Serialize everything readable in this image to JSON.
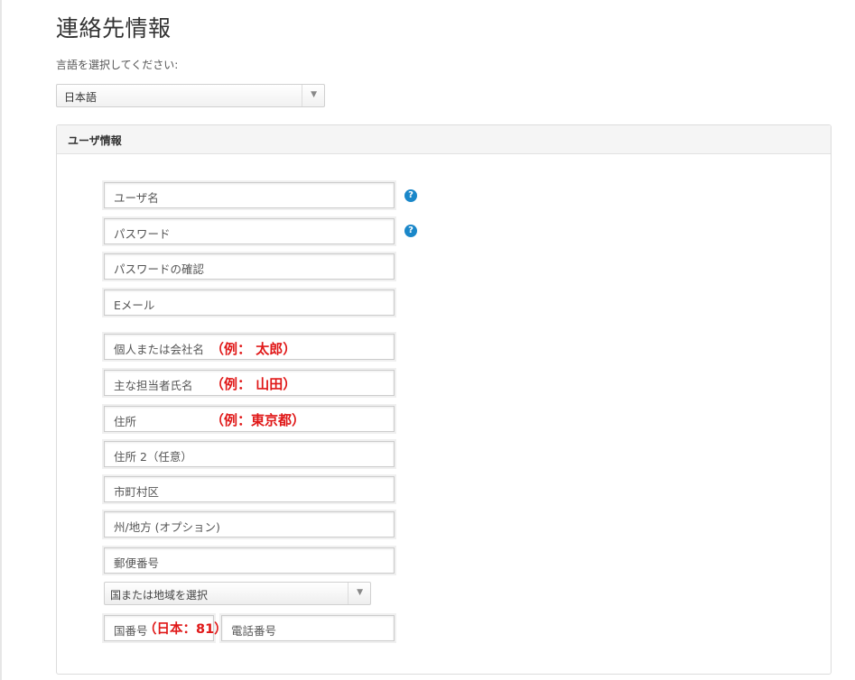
{
  "page": {
    "title": "連絡先情報"
  },
  "language": {
    "label": "言語を選択してください:",
    "selected": "日本語"
  },
  "panel": {
    "title": "ユーザ情報"
  },
  "fields": {
    "username": "ユーザ名",
    "password": "パスワード",
    "password_confirm": "パスワードの確認",
    "email": "Eメール",
    "company_name": "個人または会社名",
    "company_name_hint": "（例：  太郎）",
    "contact_name": "主な担当者氏名",
    "contact_name_hint": "（例：  山田）",
    "address": "住所",
    "address_hint": "（例：東京都）",
    "address2": "住所 2（任意）",
    "city": "市町村区",
    "state": "州/地方 (オプション)",
    "postal": "郵便番号",
    "country": "国または地域を選択",
    "country_code": "国番号",
    "country_code_hint": "（日本：81）",
    "phone": "電話番号"
  },
  "icons": {
    "help": "help-icon",
    "dropdown": "chevron-down-icon"
  },
  "colors": {
    "hint": "#e01818",
    "help": "#1a87c9"
  }
}
